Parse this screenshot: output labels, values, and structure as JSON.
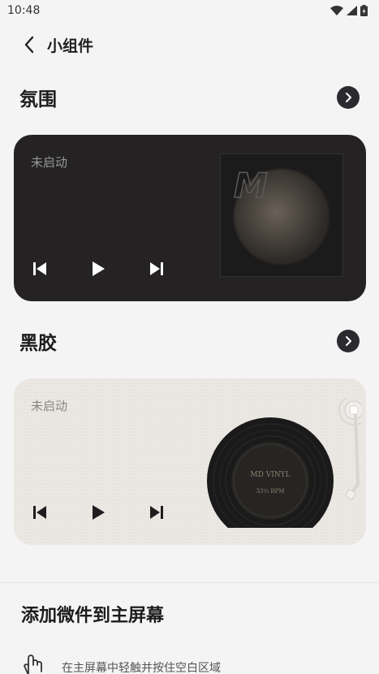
{
  "status_bar": {
    "time": "10:48"
  },
  "app_bar": {
    "title": "小组件"
  },
  "sections": [
    {
      "title": "氛围",
      "card": {
        "status": "未启动",
        "album_letter": "M"
      }
    },
    {
      "title": "黑胶",
      "card": {
        "status": "未启动",
        "vinyl_label_1": "MD VINYL",
        "vinyl_label_2": "33⅓ RPM"
      }
    }
  ],
  "add_widget": {
    "title": "添加微件到主屏幕",
    "hint": "在主屏幕中轻触并按住空白区域"
  },
  "colors": {
    "dark_card": "#242222",
    "light_card": "#ebe8e3",
    "chevron_button": "#2b2b2f"
  }
}
